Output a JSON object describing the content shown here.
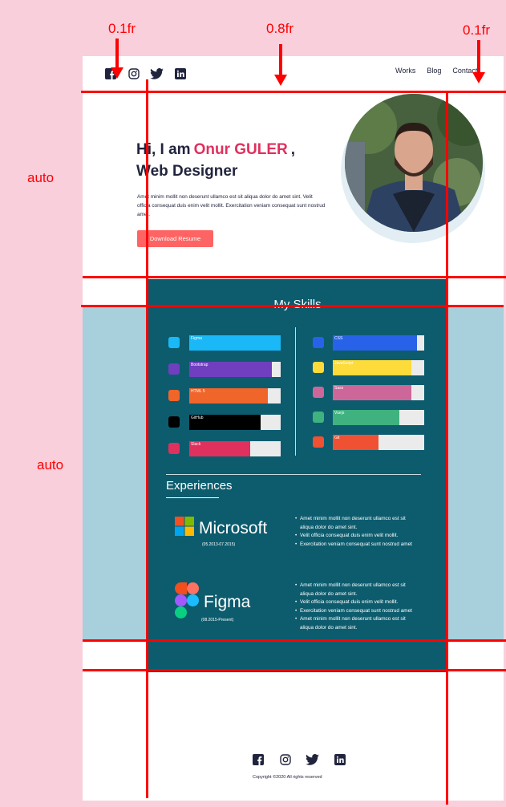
{
  "annotations": {
    "col_left": "0.1fr",
    "col_mid": "0.8fr",
    "col_right": "0.1fr",
    "row_top": "auto",
    "row_mid": "auto"
  },
  "nav": {
    "works": "Works",
    "blog": "Blog",
    "contact": "Contact"
  },
  "hero": {
    "greeting": "Hi, I am",
    "name": "Onur GULER",
    "comma": ",",
    "role": "Web Designer",
    "text": "Amet minim mollit non deserunt ullamco est sit aliqua dolor do amet sint. Velit officia consequat duis enim velit mollit. Exercitation veniam consequat sunt nostrud amet.",
    "button": "Download Resume"
  },
  "skills": {
    "title": "My Skills",
    "left": [
      {
        "label": "Figma",
        "level": 1.0,
        "color": "#1ab8f7",
        "icon": "figma-icon"
      },
      {
        "label": "Bootstrap",
        "level": 0.9,
        "color": "#6f3fbf",
        "icon": "bootstrap-icon"
      },
      {
        "label": "HTML 5",
        "level": 0.86,
        "color": "#f0652a",
        "icon": "html5-icon"
      },
      {
        "label": "GitHub",
        "level": 0.78,
        "color": "#000000",
        "icon": "github-icon"
      },
      {
        "label": "Slack",
        "level": 0.67,
        "color": "#e0305d",
        "icon": "slack-icon"
      }
    ],
    "right": [
      {
        "label": "CSS",
        "level": 0.92,
        "color": "#2862e9",
        "icon": "css3-icon"
      },
      {
        "label": "JavaScript",
        "level": 0.86,
        "color": "#fddb3a",
        "icon": "javascript-icon"
      },
      {
        "label": "Sass",
        "level": 0.86,
        "color": "#cd6799",
        "icon": "sass-icon"
      },
      {
        "label": "Vuejs",
        "level": 0.73,
        "color": "#3fb27f",
        "icon": "vuejs-icon"
      },
      {
        "label": "Git",
        "level": 0.5,
        "color": "#f05133",
        "icon": "git-icon"
      }
    ]
  },
  "experiences": {
    "title": "Experiences",
    "items": [
      {
        "company": "Microsoft",
        "date": "(05.2013-07.2015)",
        "bullets": [
          "Amet minim mollit non deserunt ullamco est sit aliqua dolor do amet sint.",
          "Velit officia consequat duis enim velit mollit.",
          "Exercitation veniam consequat sunt nostrud amet"
        ]
      },
      {
        "company": "Figma",
        "date": "(08.2015-Present)",
        "bullets": [
          "Amet minim mollit non deserunt ullamco est sit aliqua dolor do amet sint.",
          "Velit officia consequat duis enim velit mollit.",
          "Exercitation veniam consequat sunt nostrud amet",
          "Amet minim mollit non deserunt ullamco est sit aliqua dolor do amet sint."
        ]
      }
    ]
  },
  "footer": {
    "copyright": "Copyright ©2020 All rights reserved"
  }
}
